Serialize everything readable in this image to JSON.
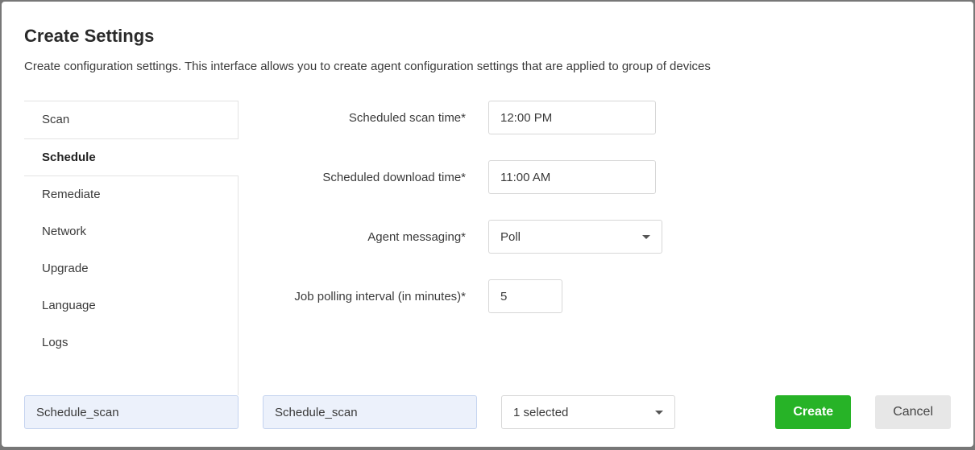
{
  "header": {
    "title": "Create Settings",
    "subtitle": "Create configuration settings. This interface allows you to create agent configuration settings that are applied to group of devices"
  },
  "sidebar": {
    "items": [
      {
        "label": "Scan",
        "active": false
      },
      {
        "label": "Schedule",
        "active": true
      },
      {
        "label": "Remediate",
        "active": false
      },
      {
        "label": "Network",
        "active": false
      },
      {
        "label": "Upgrade",
        "active": false
      },
      {
        "label": "Language",
        "active": false
      },
      {
        "label": "Logs",
        "active": false
      }
    ]
  },
  "form": {
    "scheduled_scan_time": {
      "label": "Scheduled scan time*",
      "value": "12:00 PM"
    },
    "scheduled_download_time": {
      "label": "Scheduled download time*",
      "value": "11:00 AM"
    },
    "agent_messaging": {
      "label": "Agent messaging*",
      "value": "Poll"
    },
    "job_polling_interval": {
      "label": "Job polling interval (in minutes)*",
      "value": "5"
    }
  },
  "footer": {
    "name1": "Schedule_scan",
    "name2": "Schedule_scan",
    "group_select": "1 selected",
    "create_label": "Create",
    "cancel_label": "Cancel"
  }
}
